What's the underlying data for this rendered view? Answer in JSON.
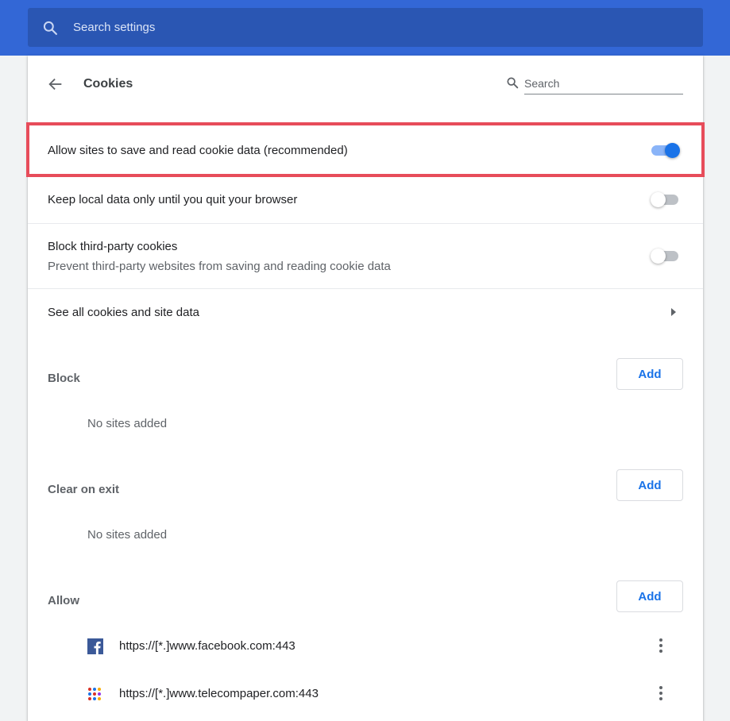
{
  "topbar": {
    "search_placeholder": "Search settings",
    "brand_color": "#3367d6"
  },
  "header": {
    "title": "Cookies",
    "search_placeholder": "Search"
  },
  "settings": [
    {
      "label": "Allow sites to save and read cookie data (recommended)",
      "sublabel": "",
      "toggle": "on",
      "highlighted": true
    },
    {
      "label": "Keep local data only until you quit your browser",
      "sublabel": "",
      "toggle": "off",
      "highlighted": false
    },
    {
      "label": "Block third-party cookies",
      "sublabel": "Prevent third-party websites from saving and reading cookie data",
      "toggle": "off",
      "highlighted": false
    }
  ],
  "see_all": {
    "label": "See all cookies and site data"
  },
  "sections": {
    "block": {
      "title": "Block",
      "add_label": "Add",
      "empty": "No sites added"
    },
    "clear_on_exit": {
      "title": "Clear on exit",
      "add_label": "Add",
      "empty": "No sites added"
    },
    "allow": {
      "title": "Allow",
      "add_label": "Add",
      "sites": [
        {
          "url": "https://[*.]www.facebook.com:443",
          "icon": "facebook-icon"
        },
        {
          "url": "https://[*.]www.telecompaper.com:443",
          "icon": "telecompaper-icon"
        }
      ]
    }
  },
  "colors": {
    "accent": "#1a73e8",
    "highlight_border": "#e74c5a"
  }
}
